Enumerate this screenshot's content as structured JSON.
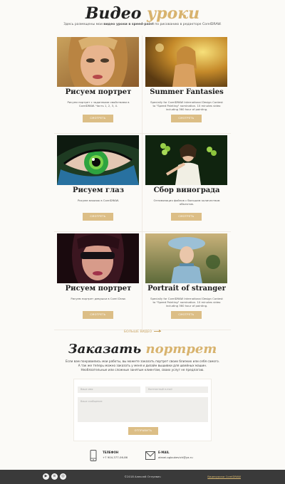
{
  "header": {
    "title_part1": "Видео",
    "title_part2": "уроки",
    "subtitle_before": "Здесь размещены мои ",
    "subtitle_bold": "видео уроки в speed-paint",
    "subtitle_after": " по рисованию в редакторе CorelDRAW."
  },
  "lessons": [
    {
      "title": "Рисуем портрет",
      "desc": "Рисуем портрет с заданными свойствами в CorelDRAW. Часть 1, 2, 3, 4.",
      "button": "СМОТРЕТЬ"
    },
    {
      "title": "Summer Fantasies",
      "desc": "Specially for CorelDRAW International Design Contest to \"Speed Painting\" nomination. 10 minutes video including 360 hour of painting.",
      "button": "СМОТРЕТЬ"
    },
    {
      "title": "Рисуем глаз",
      "desc": "Рисуем макияж в CorelDRAW.",
      "button": "СМОТРЕТЬ"
    },
    {
      "title": "Сбор винограда",
      "desc": "Оптимизация файлов с большим количеством объектов.",
      "button": "СМОТРЕТЬ"
    },
    {
      "title": "Рисуем портрет",
      "desc": "Рисуем портрет девушки в Corel Draw.",
      "button": "СМОТРЕТЬ"
    },
    {
      "title": "Portrait of stranger",
      "desc": "Specially for CorelDRAW International Design Contest to \"Speed Painting\" nomination. 10 minutes video including 360 hour of painting.",
      "button": "СМОТРЕТЬ"
    }
  ],
  "more_link": "БОЛЬШЕ ВИДЕО",
  "order": {
    "title_part1": "Заказать",
    "title_part2": "портрет",
    "text_line1": "Если вам понравились мои работы, вы можете заказать портрет своих близких или себя самого.",
    "text_line2": "А так же теперь можно заказать у меня и дизайн вышивки для швейных машин.",
    "text_line3": "Необязательные или сложные занятым клиентам, своих услуг не предлагаю."
  },
  "form": {
    "name_placeholder": "Ваше имя",
    "contact_placeholder": "Контактный e-mail",
    "message_placeholder": "Ваше сообщение",
    "submit": "ОТПРАВИТЬ"
  },
  "contacts": {
    "phone_label": "ТЕЛЕФОН",
    "phone_value": "+7 904-377-06-86",
    "email_label": "E-MAIL",
    "email_value": "alexei.ogloukevich@ya.ru"
  },
  "footer": {
    "copyright": "©2018 Алексей Оглуевич",
    "link": "Видеоуроки CorelDRAW",
    "social": [
      "youtube",
      "vk",
      "instagram"
    ]
  },
  "colors": {
    "accent": "#dcbe86",
    "title_accent": "#d8b36e",
    "footer_bg": "#3a3a3a"
  }
}
